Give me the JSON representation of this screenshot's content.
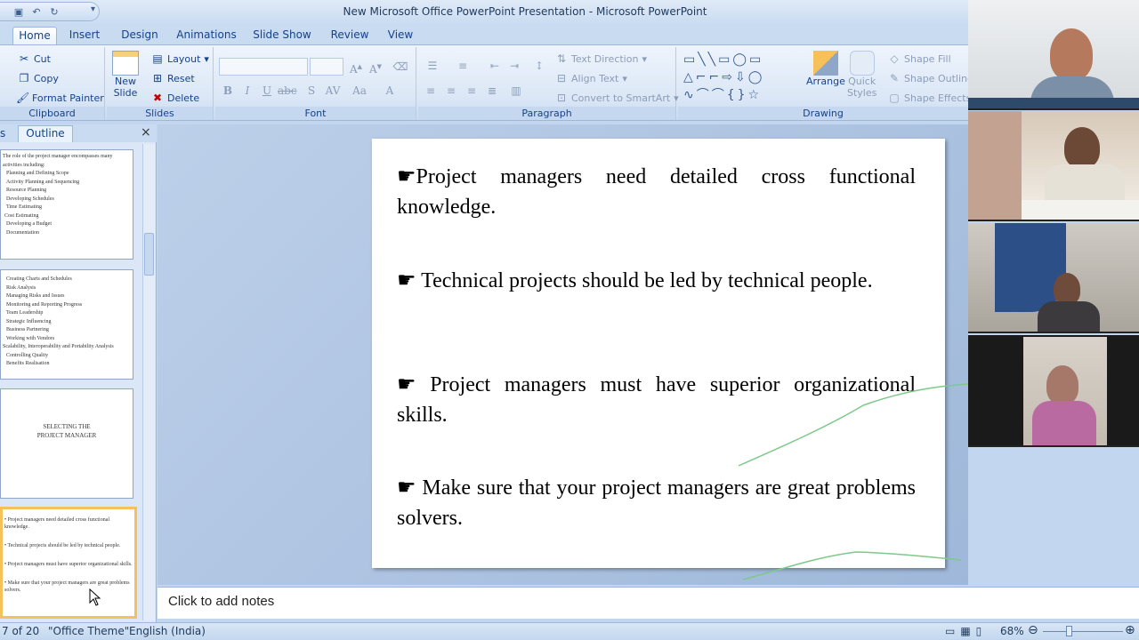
{
  "window": {
    "title": "New Microsoft Office PowerPoint Presentation - Microsoft PowerPoint"
  },
  "tabs": [
    "Home",
    "Insert",
    "Design",
    "Animations",
    "Slide Show",
    "Review",
    "View"
  ],
  "ribbon": {
    "clipboard": {
      "label": "Clipboard",
      "cut": "Cut",
      "copy": "Copy",
      "format_painter": "Format Painter"
    },
    "slides": {
      "label": "Slides",
      "new_slide": "New",
      "new_slide2": "Slide",
      "layout": "Layout",
      "reset": "Reset",
      "delete": "Delete"
    },
    "font": {
      "label": "Font"
    },
    "paragraph": {
      "label": "Paragraph",
      "text_direction": "Text Direction",
      "align_text": "Align Text",
      "convert_smartart": "Convert to SmartArt"
    },
    "drawing": {
      "label": "Drawing",
      "arrange": "Arrange",
      "quick_styles": "Quick",
      "quick_styles2": "Styles",
      "shape_fill": "Shape Fill",
      "shape_outline": "Shape Outline",
      "shape_effects": "Shape Effects"
    }
  },
  "pane": {
    "outline_tab": "Outline",
    "tab_left": "s",
    "close": "×"
  },
  "thumbnails": {
    "t1": [
      "The role of the project manager encompasses many activities including:",
      "Planning and Defining Scope",
      "Activity Planning and Sequencing",
      "Resource Planning",
      "Developing Schedules",
      "Time Estimating",
      "Cost Estimating",
      "Developing a Budget",
      "Documentation"
    ],
    "t2": [
      "Creating Charts and Schedules",
      "Risk Analysis",
      "Managing Risks and Issues",
      "Monitoring and Reporting Progress",
      "Team Leadership",
      "Strategic Influencing",
      "Business Partnering",
      "Working with Vendors",
      "Scalability, Interoperability and Portability Analysis",
      "Controlling Quality",
      "Benefits Realisation"
    ],
    "t3": [
      "SELECTING THE",
      "PROJECT MANAGER"
    ],
    "t4": [
      "• Project managers need detailed cross functional knowledge.",
      "• Technical projects should be led by technical people.",
      "• Project managers must have superior organizational skills.",
      "• Make sure that your project managers are great problems solvers."
    ]
  },
  "slide": {
    "bullets": [
      "Project managers need detailed cross functional knowledge.",
      "Technical projects should be led by technical people.",
      "Project managers must have superior organizational skills.",
      "Make sure that your project managers are great problems solvers."
    ]
  },
  "notes": {
    "placeholder": "Click to add notes"
  },
  "status": {
    "slide_count": "7 of 20",
    "theme": "\"Office Theme\"",
    "language": "English (India)",
    "zoom": "68%"
  },
  "colors": {
    "ribbon_text": "#15428b",
    "annotation": "#7ec88a"
  }
}
